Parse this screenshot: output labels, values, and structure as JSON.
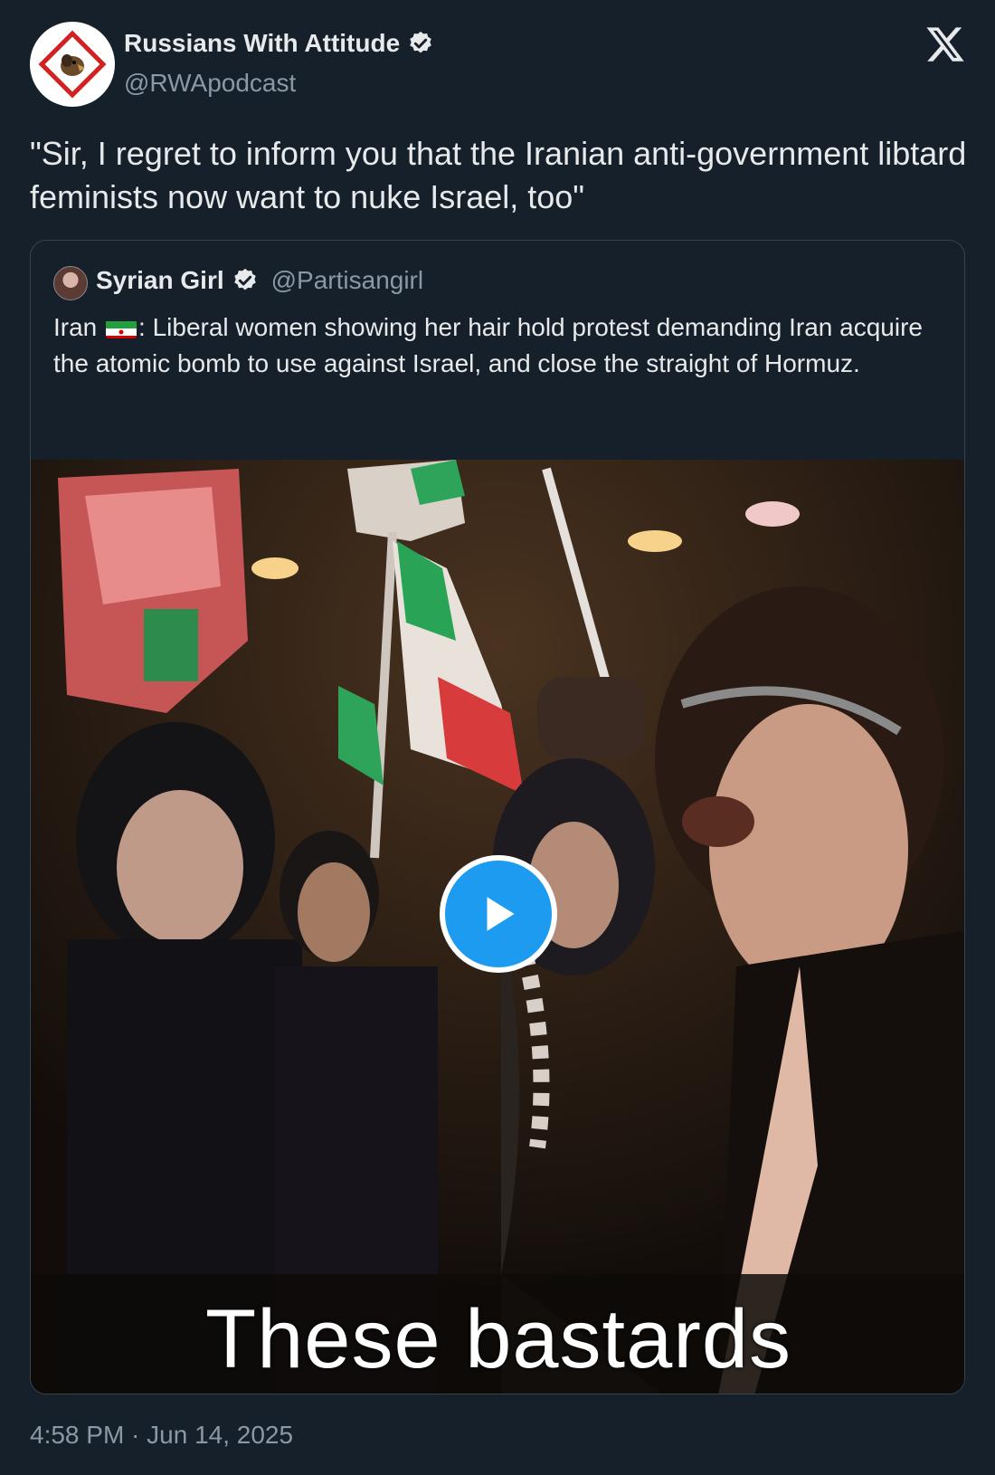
{
  "author": {
    "display_name": "Russians With Attitude",
    "handle": "@RWApodcast",
    "verified": true
  },
  "tweet": {
    "text": "\"Sir, I regret to inform you that the Iranian anti-government libtard feminists now want to nuke Israel, too\"",
    "timestamp": "4:58 PM · Jun 14, 2025"
  },
  "quoted": {
    "display_name": "Syrian Girl",
    "handle": "@Partisangirl",
    "verified": true,
    "text_before_flag": "Iran ",
    "text_after_flag": ": Liberal women showing her hair hold protest demanding Iran acquire the atomic bomb to use against Israel, and close the straight of Hormuz.",
    "media": {
      "type": "video",
      "caption": "These bastards"
    }
  },
  "icons": {
    "platform": "x-logo-icon",
    "verified": "verified-badge-icon",
    "play": "play-icon"
  },
  "colors": {
    "background": "#15202b",
    "text": "#e7e9ea",
    "secondary": "#8b98a5",
    "accent": "#1d9bf0",
    "border": "#38444d"
  }
}
